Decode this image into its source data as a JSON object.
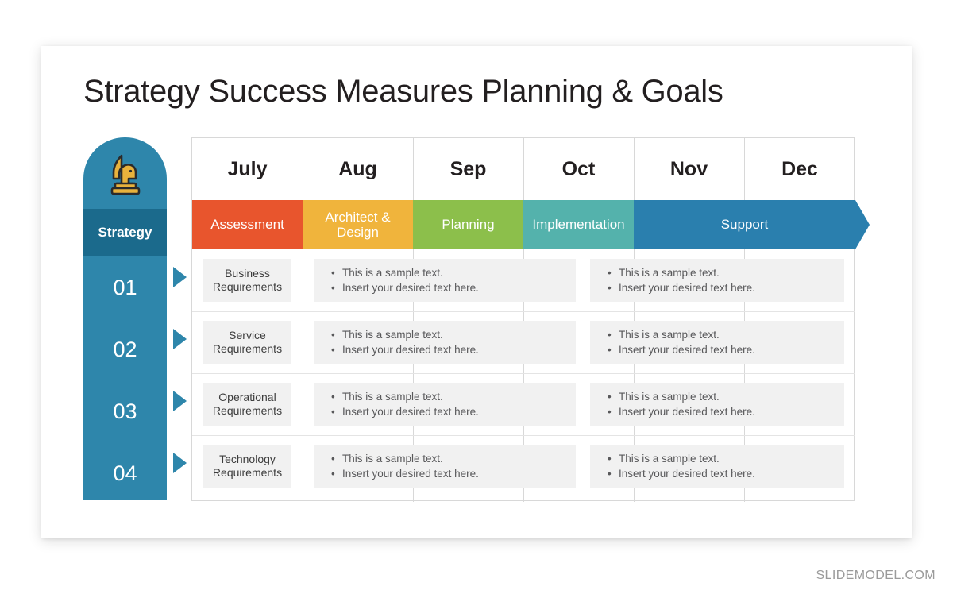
{
  "slide": {
    "title": "Strategy Success Measures Planning & Goals",
    "footer": "SLIDEMODEL.COM"
  },
  "sidebar": {
    "icon": "chess-knight-icon",
    "label": "Strategy",
    "cap_color": "#2e86ab",
    "strategy_band_color": "#1b6a8c",
    "body_color": "#2e86ab",
    "numbers": [
      "01",
      "02",
      "03",
      "04"
    ]
  },
  "months": [
    "July",
    "Aug",
    "Sep",
    "Oct",
    "Nov",
    "Dec"
  ],
  "phases": [
    {
      "label": "Assessment",
      "color": "#e8552d",
      "span": 1
    },
    {
      "label": "Architect & Design",
      "color": "#f0b43c",
      "span": 1
    },
    {
      "label": "Planning",
      "color": "#8cbf4b",
      "span": 1
    },
    {
      "label": "Implementation",
      "color": "#54b2ac",
      "span": 1
    },
    {
      "label": "Support",
      "color": "#2a7fae",
      "span": 2
    }
  ],
  "rows": [
    {
      "number": "01",
      "label": "Business Requirements",
      "blocks": [
        {
          "bullets": [
            "This is a sample text.",
            "Insert your desired text here."
          ]
        },
        {
          "bullets": [
            "This is a sample text.",
            "Insert your desired text here."
          ]
        }
      ]
    },
    {
      "number": "02",
      "label": "Service Requirements",
      "blocks": [
        {
          "bullets": [
            "This is a sample text.",
            "Insert your desired text here."
          ]
        },
        {
          "bullets": [
            "This is a sample text.",
            "Insert your desired text here."
          ]
        }
      ]
    },
    {
      "number": "03",
      "label": "Operational Requirements",
      "blocks": [
        {
          "bullets": [
            "This is a sample text.",
            "Insert your desired text here."
          ]
        },
        {
          "bullets": [
            "This is a sample text.",
            "Insert your desired text here."
          ]
        }
      ]
    },
    {
      "number": "04",
      "label": "Technology Requirements",
      "blocks": [
        {
          "bullets": [
            "This is a sample text.",
            "Insert your desired text here."
          ]
        },
        {
          "bullets": [
            "This is a sample text.",
            "Insert your desired text here."
          ]
        }
      ]
    }
  ],
  "colors": {
    "accent_blue": "#2e86ab",
    "dark_blue": "#1b6a8c",
    "block_gray": "#f1f1f1",
    "grid_line": "#d8d8d8",
    "title_text": "#231f20"
  }
}
